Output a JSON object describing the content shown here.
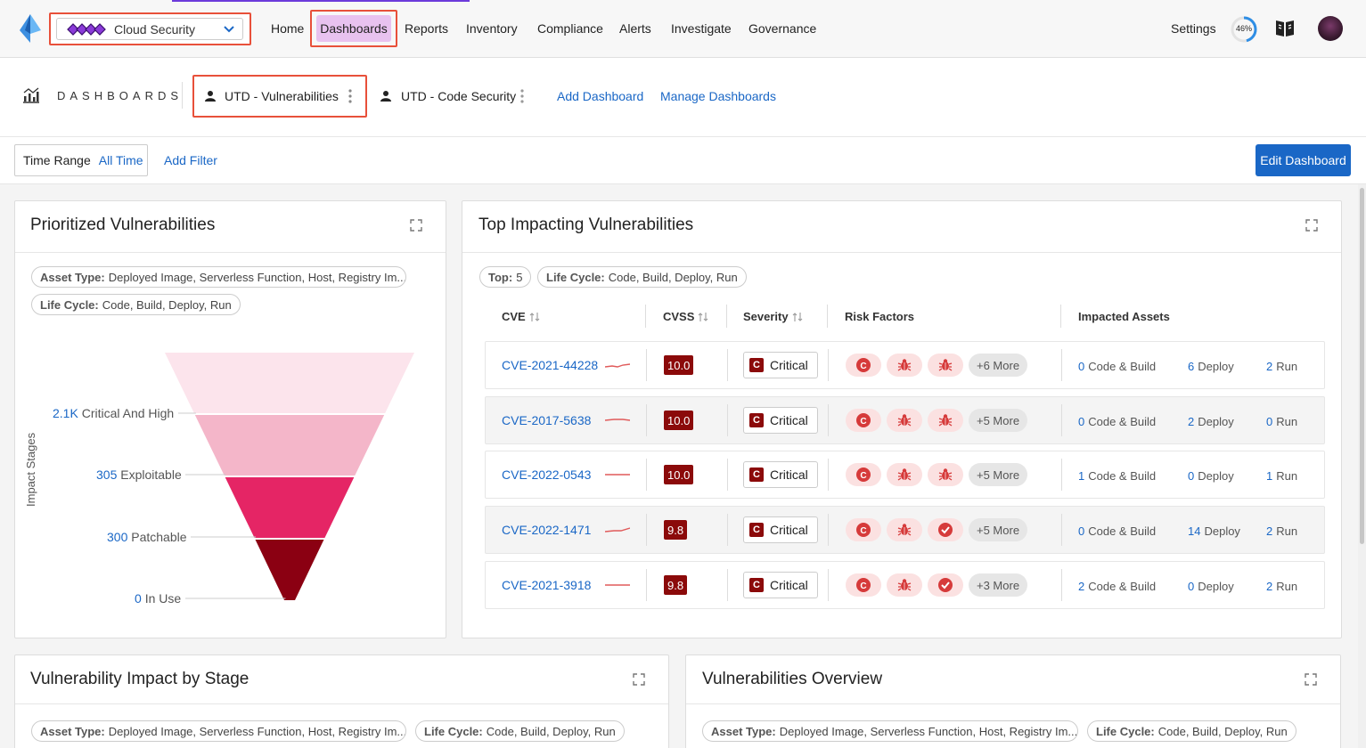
{
  "nav": {
    "product": "Cloud Security",
    "items": [
      "Home",
      "Dashboards",
      "Reports",
      "Inventory",
      "Compliance",
      "Alerts",
      "Investigate",
      "Governance"
    ],
    "settings": "Settings",
    "progress": "46%",
    "progress_value": 46
  },
  "tabbar": {
    "title": "DASHBOARDS",
    "tabs": [
      "UTD - Vulnerabilities",
      "UTD - Code Security"
    ],
    "add": "Add Dashboard",
    "manage": "Manage Dashboards"
  },
  "filterbar": {
    "time_label": "Time Range",
    "time_value": "All Time",
    "add_filter": "Add Filter",
    "edit": "Edit Dashboard"
  },
  "prioritized": {
    "title": "Prioritized Vulnerabilities",
    "chips": [
      {
        "key": "Asset Type:",
        "value": "Deployed Image, Serverless Function, Host, Registry Im..."
      },
      {
        "key": "Life Cycle:",
        "value": "Code, Build, Deploy, Run"
      }
    ],
    "y_label": "Impact Stages",
    "chart_data": {
      "type": "funnel",
      "stages": [
        {
          "num": "2.1K",
          "label": "Critical And High",
          "color": "#fce4ec"
        },
        {
          "num": "305",
          "label": "Exploitable",
          "color": "#f4b6c9"
        },
        {
          "num": "300",
          "label": "Patchable",
          "color": "#e52565"
        },
        {
          "num": "0",
          "label": "In Use",
          "color": "#8b0012"
        }
      ]
    }
  },
  "top": {
    "title": "Top Impacting Vulnerabilities",
    "chips": [
      {
        "key": "Top:",
        "value": "5"
      },
      {
        "key": "Life Cycle:",
        "value": "Code, Build, Deploy, Run"
      }
    ],
    "headers": [
      "CVE",
      "CVSS",
      "Severity",
      "Risk Factors",
      "Impacted Assets"
    ],
    "rows": [
      {
        "cve": "CVE-2021-44228",
        "cvss": "10.0",
        "severity": "Critical",
        "risk": [
          "c-icon",
          "bug-icon",
          "bug-icon"
        ],
        "more": "+6 More",
        "code": "0",
        "deploy": "6",
        "run": "2"
      },
      {
        "cve": "CVE-2017-5638",
        "cvss": "10.0",
        "severity": "Critical",
        "risk": [
          "c-icon",
          "bug-icon",
          "bug-icon"
        ],
        "more": "+5 More",
        "code": "0",
        "deploy": "2",
        "run": "0"
      },
      {
        "cve": "CVE-2022-0543",
        "cvss": "10.0",
        "severity": "Critical",
        "risk": [
          "c-icon",
          "bug-icon",
          "bug-icon"
        ],
        "more": "+5 More",
        "code": "1",
        "deploy": "0",
        "run": "1"
      },
      {
        "cve": "CVE-2022-1471",
        "cvss": "9.8",
        "severity": "Critical",
        "risk": [
          "c-icon",
          "bug-icon",
          "check-icon"
        ],
        "more": "+5 More",
        "code": "0",
        "deploy": "14",
        "run": "2"
      },
      {
        "cve": "CVE-2021-3918",
        "cvss": "9.8",
        "severity": "Critical",
        "risk": [
          "c-icon",
          "bug-icon",
          "check-icon"
        ],
        "more": "+3 More",
        "code": "2",
        "deploy": "0",
        "run": "2"
      }
    ],
    "asset_labels": {
      "code": "Code & Build",
      "deploy": "Deploy",
      "run": "Run"
    }
  },
  "impact": {
    "title": "Vulnerability Impact by Stage",
    "chips": [
      {
        "key": "Asset Type:",
        "value": "Deployed Image, Serverless Function, Host, Registry Im..."
      },
      {
        "key": "Life Cycle:",
        "value": "Code, Build, Deploy, Run"
      }
    ]
  },
  "overview": {
    "title": "Vulnerabilities Overview",
    "chips": [
      {
        "key": "Asset Type:",
        "value": "Deployed Image, Serverless Function, Host, Registry Im..."
      },
      {
        "key": "Life Cycle:",
        "value": "Code, Build, Deploy, Run"
      }
    ]
  },
  "colors": {
    "accent": "#1a67c6",
    "critical": "#8b0a0a",
    "highlight": "#e8503a"
  }
}
